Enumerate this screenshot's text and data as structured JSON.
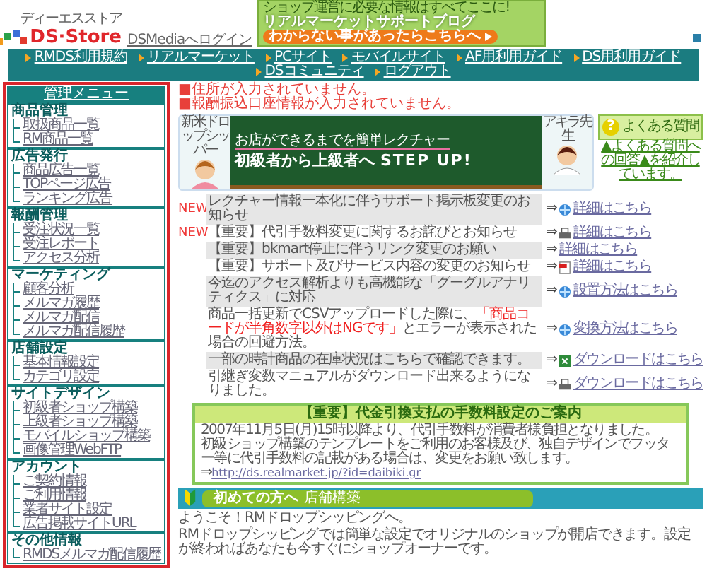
{
  "header": {
    "logo": "DS·Store",
    "logo_reading": "ディーエスストア",
    "login_link": "DSMediaへログイン",
    "ad_lines": [
      "ショップ運営に必要な情報はすべてここに!",
      "リアルマーケットサポートブログ",
      "わからない事があったらこちらへ"
    ]
  },
  "nav": [
    "RMDS利用規約",
    "リアルマーケット",
    "PCサイト",
    "モバイルサイト",
    "AF用利用ガイド",
    "DS用利用ガイド",
    "DSコミュニティ",
    "ログアウト"
  ],
  "sidebar": {
    "title": "管理メニュー",
    "sections": [
      {
        "heading": "商品管理",
        "items": [
          "取扱商品一覧",
          "RM商品一覧"
        ]
      },
      {
        "heading": "広告発行",
        "items": [
          "商品広告一覧",
          "TOPページ広告",
          "ランキング広告"
        ]
      },
      {
        "heading": "報酬管理",
        "items": [
          "受注状況一覧",
          "受注レポート",
          "アクセス分析"
        ]
      },
      {
        "heading": "マーケティング",
        "items": [
          "顧客分析",
          "メルマガ履歴",
          "メルマガ配信",
          "メルマガ配信履歴"
        ]
      },
      {
        "heading": "店舗設定",
        "items": [
          "基本情報設定",
          "カテゴリ設定"
        ]
      },
      {
        "heading": "サイトデザイン",
        "items": [
          "初級者ショップ構築",
          "上級者ショップ構築",
          "モバイルショップ構築",
          "画像管理WebFTP"
        ]
      },
      {
        "heading": "アカウント",
        "items": [
          "ご契約情報",
          "ご利用情報",
          "業者サイト設定",
          "広告掲載サイトURL"
        ]
      },
      {
        "heading": "その他情報",
        "items": [
          "RMDSメルマガ配信履歴"
        ]
      }
    ]
  },
  "warnings": [
    "■住所が入力されていません。",
    "■報酬振込口座情報が入力されていません。"
  ],
  "banner": {
    "caption": "お店ができるまでを簡単レクチャー",
    "headline": "初級者から上級者へ",
    "step": "STEP UP!",
    "left_label": "新米ドロップシッパー",
    "right_label": "アキラ先生"
  },
  "faq": {
    "icon": "?",
    "button": "よくある質問",
    "note": "▲よくある質問への回答▲を紹介しています。"
  },
  "news": [
    {
      "badge": "NEW",
      "parts": [
        {
          "text": "レクチャー情報一本化に伴うサポート掲示板変更のお知らせ",
          "red": false
        }
      ],
      "arrow": "⇒",
      "kind": "globe",
      "link": "詳細はこちら"
    },
    {
      "badge": "NEW",
      "parts": [
        {
          "text": "【重要】代引手数料変更に関するお詫びとお知らせ",
          "red": false
        }
      ],
      "arrow": "⇒",
      "kind": "printer",
      "link": "詳細はこちら"
    },
    {
      "parts": [
        {
          "text": "【重要】bkmart停止に伴うリンク変更のお願い",
          "red": false
        }
      ],
      "arrow": "⇒",
      "link": "詳細はこちら"
    },
    {
      "parts": [
        {
          "text": "【重要】サポート及びサービス内容の変更のお知らせ",
          "red": false
        }
      ],
      "arrow": "⇒",
      "kind": "pdf",
      "link": "詳細はこちら"
    },
    {
      "parts": [
        {
          "text": "今迄のアクセス解析よりも高機能な「グーグルアナリティクス」に対応",
          "red": false
        }
      ],
      "arrow": "⇒",
      "kind": "globe",
      "link": "設置方法はこちら"
    },
    {
      "parts": [
        {
          "text": "商品一括更新でCSVアップロードした際に、",
          "red": false
        },
        {
          "text": "「商品コードが半角数字以外はNGです」",
          "red": true
        },
        {
          "text": "とエラーが表示された場合の回避方法。",
          "red": false
        }
      ],
      "arrow": "⇒",
      "kind": "globe",
      "link": "変換方法はこちら"
    },
    {
      "parts": [
        {
          "text": "一部の時計商品の在庫状況はこちらで確認できます。",
          "red": false
        }
      ],
      "arrow": "⇒",
      "kind": "sheet",
      "link": "ダウンロードはこちら"
    },
    {
      "parts": [
        {
          "text": "引継ぎ変数マニュアルがダウンロード出来るようになりました。",
          "red": false
        }
      ],
      "arrow": "⇒",
      "kind": "printer",
      "link": "ダウンロードはこちら"
    }
  ],
  "notice": {
    "title": "【重要】代金引換支払の手数料設定のご案内",
    "lines": [
      "2007年11月5日(月)15時以降より、代引手数料が消費者様負担となりました。",
      "初級ショップ構築のテンプレートをご利用のお客様及び、独自デザインでフッター等に代引手数料の記載がある場合は、変更をお願い致します。"
    ],
    "arrow": "⇒",
    "link": "http://ds.realmarket.jp/?id=daibiki.gr"
  },
  "intro": {
    "title": "初めての方へ",
    "subtitle": "店舗構築",
    "paragraphs": [
      "ようこそ！RMドロップシッピングへ。",
      "RMドロップシッピングでは簡単な設定でオリジナルのショップが開店できます。設定が終わればあなたも今すぐにショップオーナーです。"
    ]
  }
}
